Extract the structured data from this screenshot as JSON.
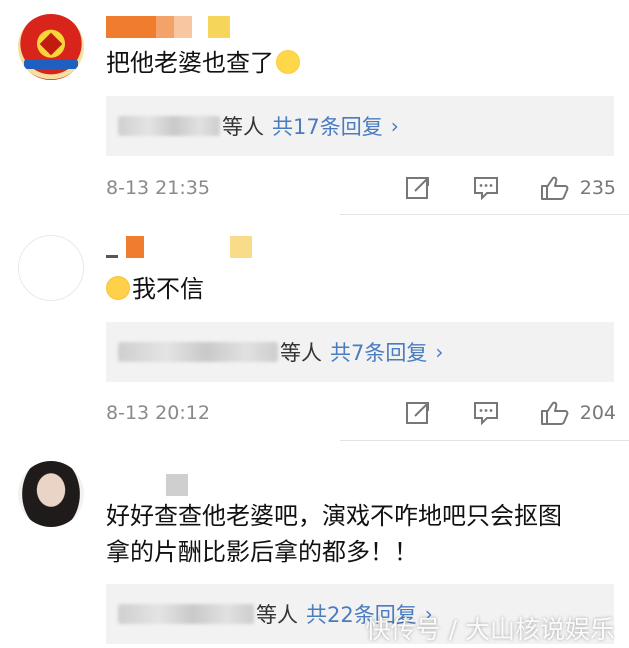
{
  "comments": [
    {
      "text": "把他老婆也查了",
      "emoji": "smile-emoji",
      "reply_people": "等人",
      "reply_count": "共17条回复",
      "time": "8-13 21:35",
      "likes": "235"
    },
    {
      "text": "我不信",
      "emoji": "yum-emoji",
      "reply_people": "等人",
      "reply_count": "共7条回复",
      "time": "8-13 20:12",
      "likes": "204"
    },
    {
      "text_line1": "好好查查他老婆吧，演戏不咋地吧只会抠图",
      "text_line2": "拿的片酬比影后拿的都多！！",
      "reply_people": "等人",
      "reply_count": "共22条回复"
    }
  ],
  "reply_chevron": "›",
  "watermark": "快传号 / 大山核说娱乐",
  "colors": {
    "link": "#4a7cbf",
    "meta": "#8a8a8a",
    "reply_bg": "#f2f2f2"
  },
  "icons": [
    "share-icon",
    "comment-icon",
    "thumb-up-icon"
  ]
}
